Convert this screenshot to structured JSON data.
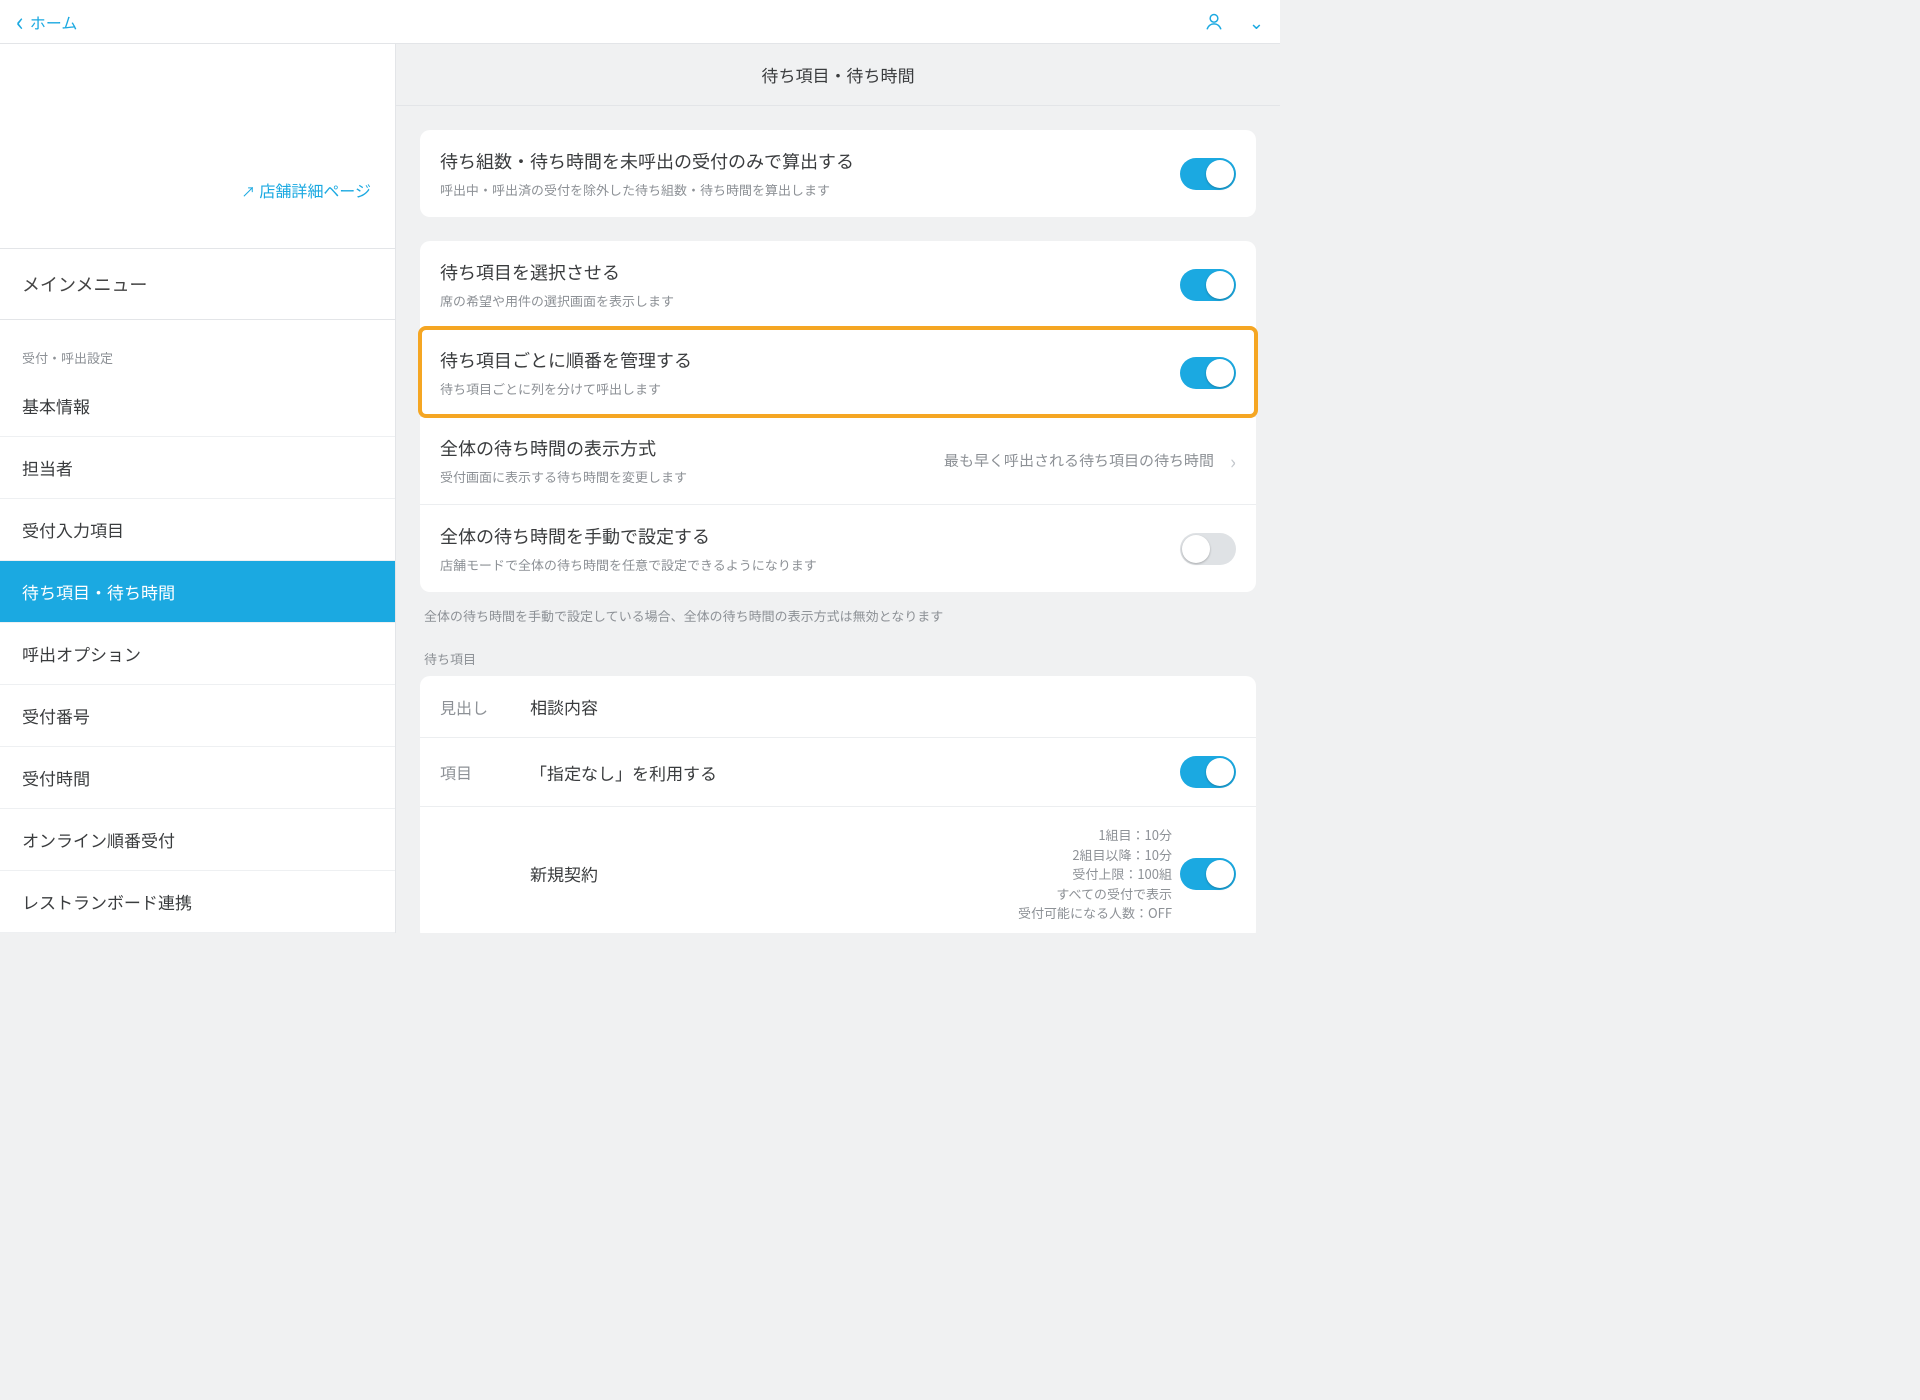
{
  "header": {
    "back_label": "ホーム"
  },
  "sidebar": {
    "store_detail_link": "店舗詳細ページ",
    "main_menu_label": "メインメニュー",
    "section_caption": "受付・呼出設定",
    "items": [
      {
        "label": "基本情報"
      },
      {
        "label": "担当者"
      },
      {
        "label": "受付入力項目"
      },
      {
        "label": "待ち項目・待ち時間"
      },
      {
        "label": "呼出オプション"
      },
      {
        "label": "受付番号"
      },
      {
        "label": "受付時間"
      },
      {
        "label": "オンライン順番受付"
      },
      {
        "label": "レストランボード連携"
      }
    ]
  },
  "main": {
    "title": "待ち項目・待ち時間",
    "card1": {
      "title": "待ち組数・待ち時間を未呼出の受付のみで算出する",
      "sub": "呼出中・呼出済の受付を除外した待ち組数・待ち時間を算出します"
    },
    "card2": {
      "r1": {
        "title": "待ち項目を選択させる",
        "sub": "席の希望や用件の選択画面を表示します"
      },
      "r2": {
        "title": "待ち項目ごとに順番を管理する",
        "sub": "待ち項目ごとに列を分けて呼出します"
      },
      "r3": {
        "title": "全体の待ち時間の表示方式",
        "sub": "受付画面に表示する待ち時間を変更します",
        "value": "最も早く呼出される待ち項目の待ち時間"
      },
      "r4": {
        "title": "全体の待ち時間を手動で設定する",
        "sub": "店舗モードで全体の待ち時間を任意で設定できるようになります"
      }
    },
    "footnote": "全体の待ち時間を手動で設定している場合、全体の待ち時間の表示方式は無効となります",
    "group_caption": "待ち項目",
    "card3": {
      "heading_label": "見出し",
      "heading_value": "相談内容",
      "item_label": "項目",
      "item_value": "「指定なし」を利用する",
      "entry_name": "新規契約",
      "meta": {
        "l1": "1組目：10分",
        "l2": "2組目以降：10分",
        "l3": "受付上限：100組",
        "l4": "すべての受付で表示",
        "l5": "受付可能になる人数：OFF"
      }
    }
  }
}
